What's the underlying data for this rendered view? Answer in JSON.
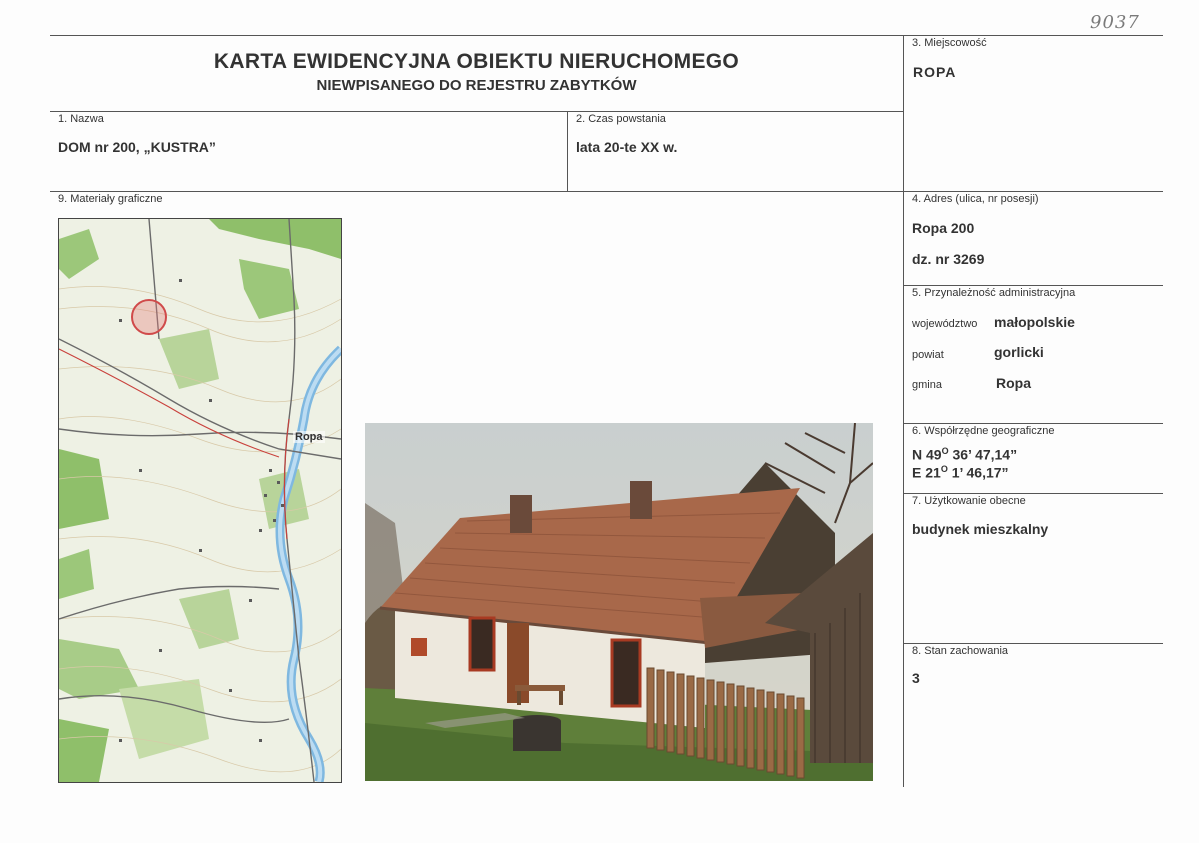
{
  "handwritten_number": "9037",
  "title": {
    "line1": "KARTA EWIDENCYJNA OBIEKTU NIERUCHOMEGO",
    "line2": "NIEWPISANEGO DO REJESTRU ZABYTKÓW"
  },
  "fields": {
    "miejscowosc": {
      "label": "3. Miejscowość",
      "value": "ROPA"
    },
    "nazwa": {
      "label": "1. Nazwa",
      "value": "DOM nr 200, „KUSTRA”"
    },
    "czas": {
      "label": "2. Czas powstania",
      "value": "lata 20-te XX w."
    },
    "materialy": {
      "label": "9. Materiały graficzne"
    },
    "adres": {
      "label": "4. Adres (ulica, nr posesji)",
      "line1": "Ropa 200",
      "line2": "dz. nr 3269"
    },
    "przynaleznosc": {
      "label": "5. Przynależność administracyjna",
      "wojewodztwo_label": "województwo",
      "wojewodztwo": "małopolskie",
      "powiat_label": "powiat",
      "powiat": "gorlicki",
      "gmina_label": "gmina",
      "gmina": "Ropa"
    },
    "wspolrzedne": {
      "label": "6. Współrzędne geograficzne",
      "n_prefix": "N 49",
      "n_rest": " 36’ 47,14”",
      "e_prefix": "E 21",
      "e_rest": " 1’ 46,17”",
      "degree": "O"
    },
    "uzytkowanie": {
      "label": "7. Użytkowanie obecne",
      "value": "budynek mieszkalny"
    },
    "stan": {
      "label": "8. Stan zachowania",
      "value": "3"
    }
  },
  "map": {
    "town_label": "Ropa"
  }
}
